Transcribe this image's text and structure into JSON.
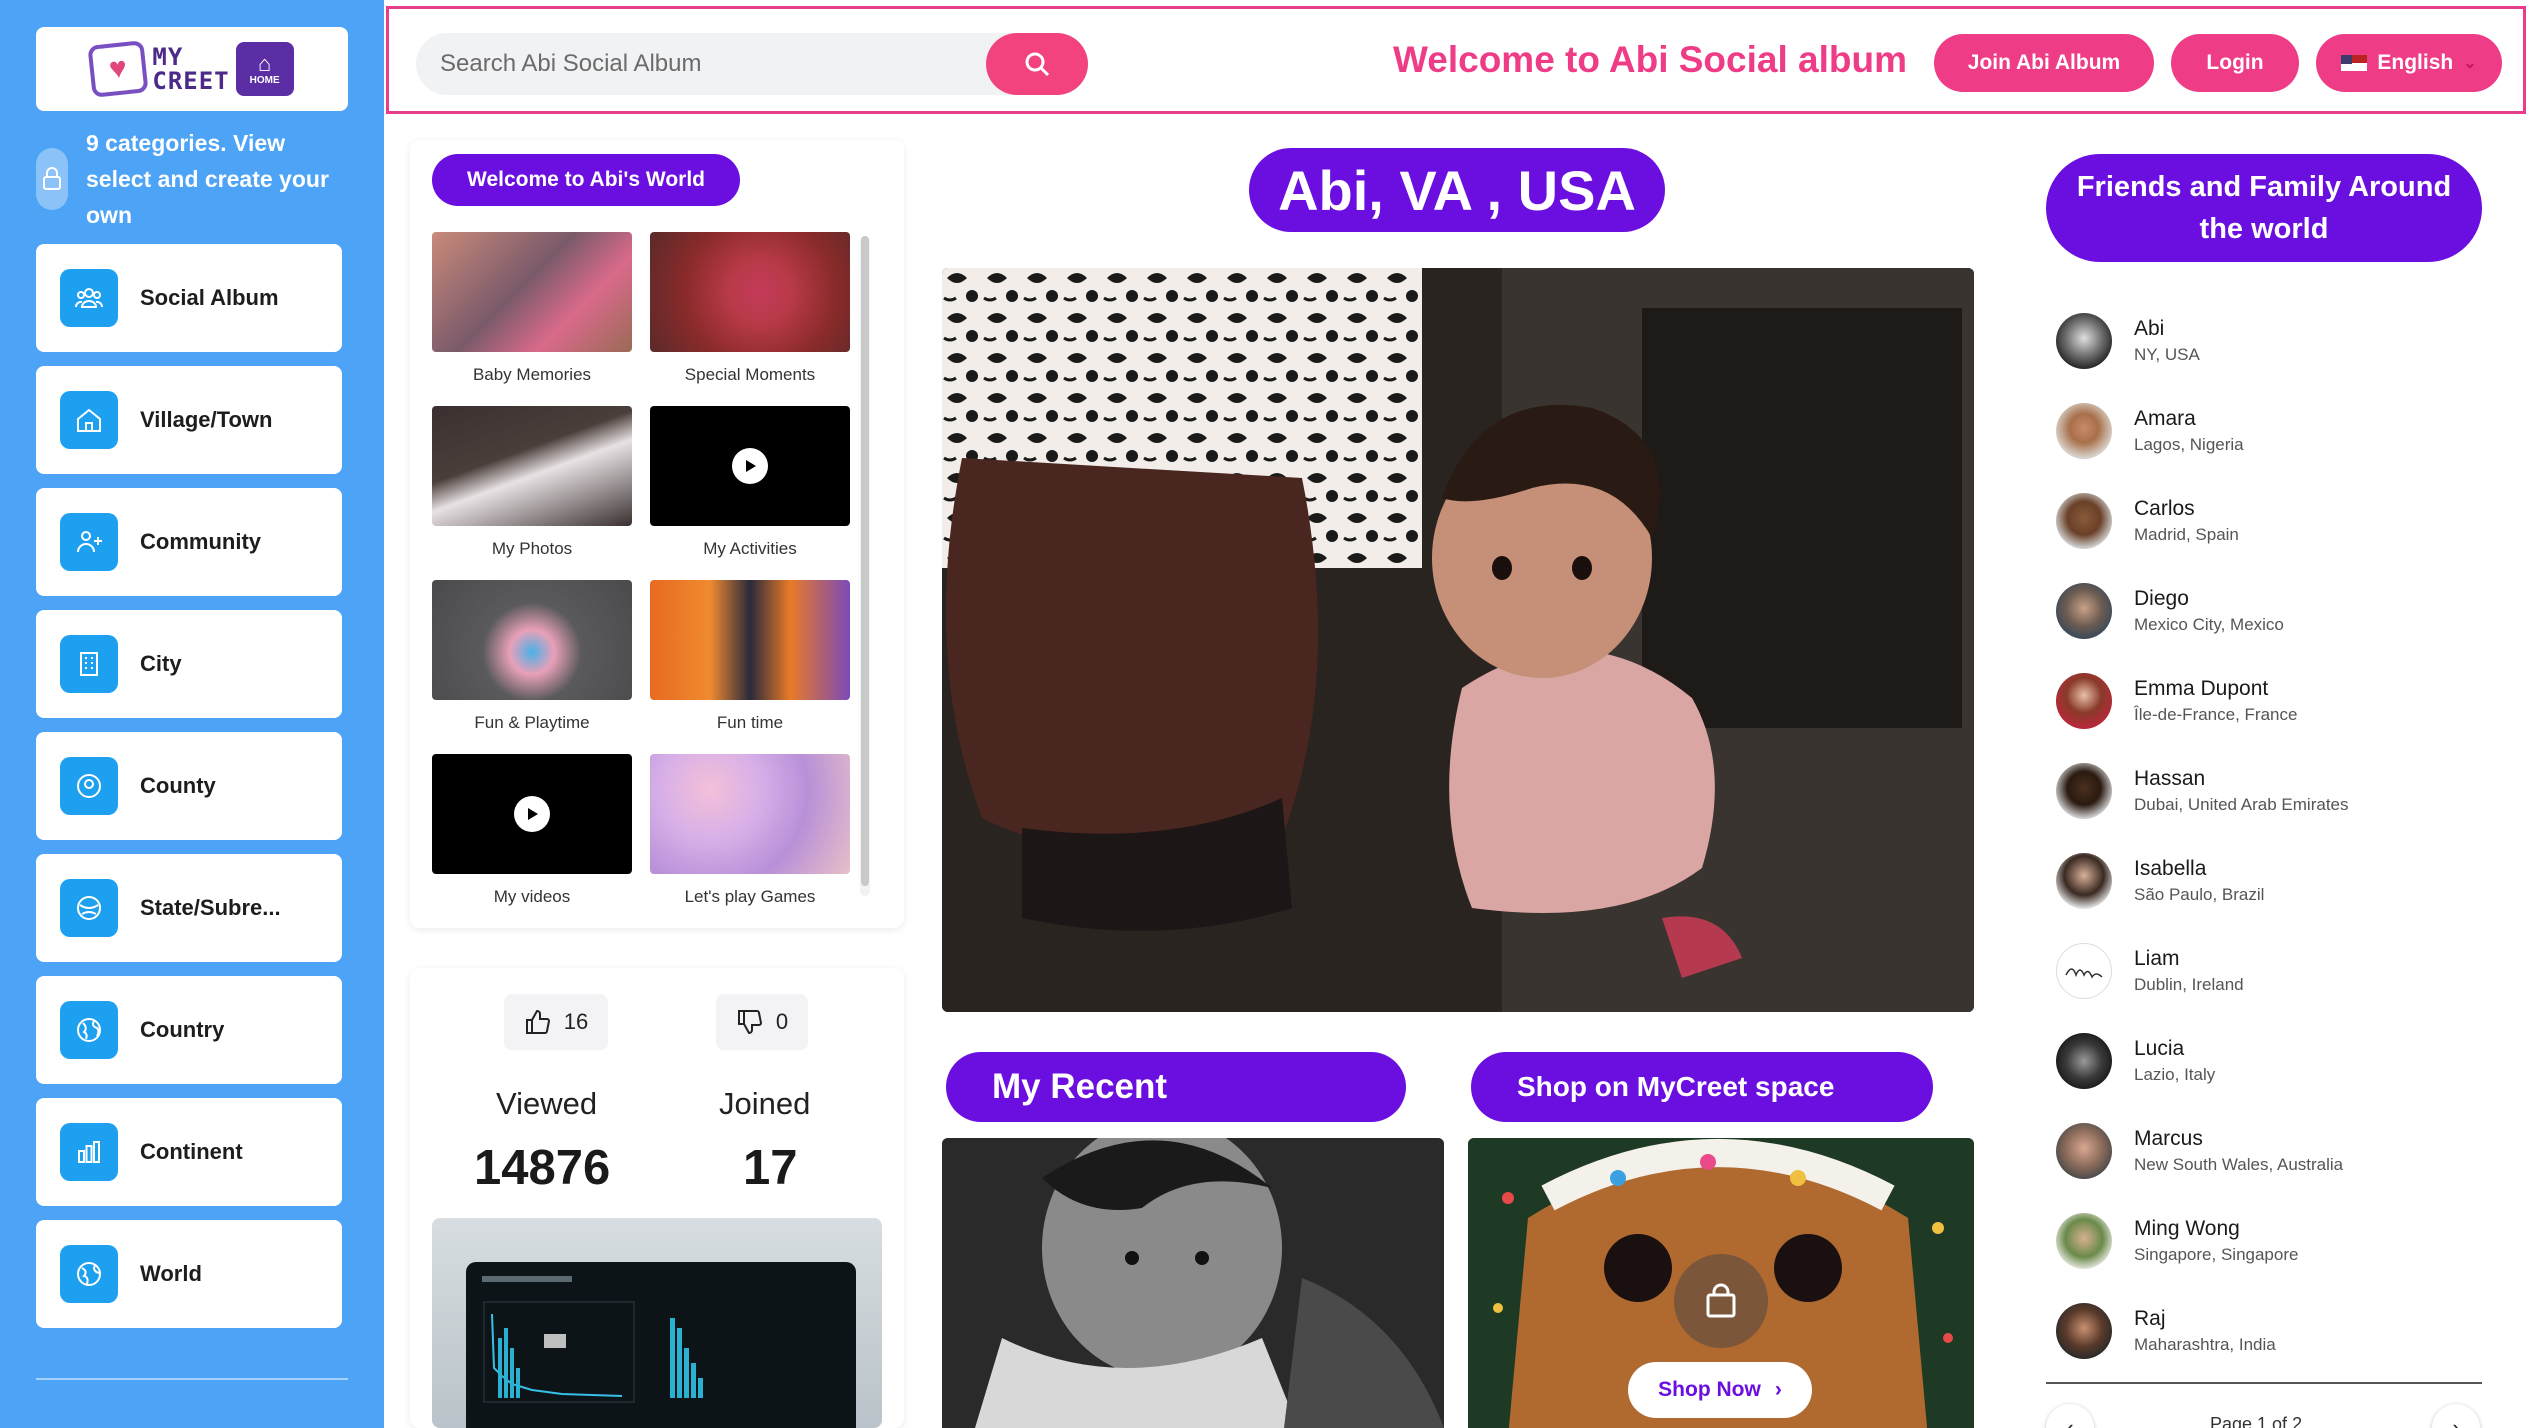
{
  "logo": {
    "line1": "MY",
    "line2": "CREET",
    "home_label": "HOME"
  },
  "sidebar": {
    "intro": "9 categories. View select and create your own",
    "items": [
      {
        "label": "Social Album",
        "icon": "people-group-icon"
      },
      {
        "label": "Village/Town",
        "icon": "home-icon"
      },
      {
        "label": "Community",
        "icon": "community-icon"
      },
      {
        "label": "City",
        "icon": "building-icon"
      },
      {
        "label": "County",
        "icon": "location-pin-icon"
      },
      {
        "label": "State/Subre...",
        "icon": "globe-region-icon"
      },
      {
        "label": "Country",
        "icon": "globe-icon"
      },
      {
        "label": "Continent",
        "icon": "bar-chart-icon"
      },
      {
        "label": "World",
        "icon": "world-icon"
      }
    ]
  },
  "topbar": {
    "search_placeholder": "Search Abi Social Album",
    "welcome": "Welcome to Abi Social album",
    "join_label": "Join Abi Album",
    "login_label": "Login",
    "language": "English"
  },
  "world": {
    "tag": "Welcome to Abi's World",
    "albums": [
      {
        "label": "Baby Memories",
        "video": false
      },
      {
        "label": "Special Moments",
        "video": false
      },
      {
        "label": "My Photos",
        "video": false
      },
      {
        "label": "My Activities",
        "video": true
      },
      {
        "label": "Fun & Playtime",
        "video": false
      },
      {
        "label": "Fun time",
        "video": false
      },
      {
        "label": "My videos",
        "video": true
      },
      {
        "label": "Let's play Games",
        "video": false
      }
    ]
  },
  "stats": {
    "likes": "16",
    "dislikes": "0",
    "viewed_label": "Viewed",
    "viewed_value": "14876",
    "joined_label": "Joined",
    "joined_value": "17"
  },
  "center": {
    "location_title": "Abi, VA , USA",
    "recent_label": "My Recent",
    "shop_label": "Shop on MyCreet space",
    "shop_now": "Shop Now"
  },
  "friends": {
    "title": "Friends and Family Around the world",
    "list": [
      {
        "name": "Abi",
        "location": "NY, USA"
      },
      {
        "name": "Amara",
        "location": "Lagos, Nigeria"
      },
      {
        "name": "Carlos",
        "location": "Madrid, Spain"
      },
      {
        "name": "Diego",
        "location": "Mexico City, Mexico"
      },
      {
        "name": "Emma Dupont",
        "location": "Île-de-France, France"
      },
      {
        "name": "Hassan",
        "location": "Dubai, United Arab Emirates"
      },
      {
        "name": "Isabella",
        "location": "São Paulo, Brazil"
      },
      {
        "name": "Liam",
        "location": "Dublin, Ireland"
      },
      {
        "name": "Lucia",
        "location": "Lazio, Italy"
      },
      {
        "name": "Marcus",
        "location": "New South Wales, Australia"
      },
      {
        "name": "Ming Wong",
        "location": "Singapore, Singapore"
      },
      {
        "name": "Raj",
        "location": "Maharashtra, India"
      }
    ],
    "pager": "Page 1 of 2"
  },
  "colors": {
    "sidebar_bg": "#4da3f5",
    "accent_pink": "#ef3c86",
    "accent_purple": "#6a0fe0",
    "nav_icon_bg": "#1ea0f1"
  }
}
